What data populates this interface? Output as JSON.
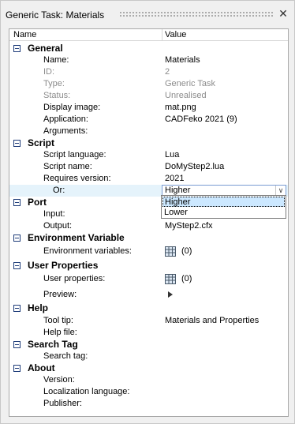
{
  "window": {
    "title": "Generic Task: Materials"
  },
  "header": {
    "name": "Name",
    "value": "Value"
  },
  "general": {
    "label": "General",
    "name_label": "Name:",
    "name_value": "Materials",
    "id_label": "ID:",
    "id_value": "2",
    "type_label": "Type:",
    "type_value": "Generic Task",
    "status_label": "Status:",
    "status_value": "Unrealised",
    "display_image_label": "Display image:",
    "display_image_value": "mat.png",
    "application_label": "Application:",
    "application_value": "CADFeko 2021 (9)",
    "arguments_label": "Arguments:"
  },
  "script": {
    "label": "Script",
    "language_label": "Script language:",
    "language_value": "Lua",
    "name_label": "Script name:",
    "name_value": "DoMyStep2.lua",
    "requires_label": "Requires version:",
    "requires_value": "2021",
    "or_label": "Or:",
    "or_value": "Higher",
    "or_options": [
      "Higher",
      "Lower"
    ]
  },
  "port": {
    "label": "Port",
    "input_label": "Input:",
    "output_label": "Output:",
    "output_value": "MyStep2.cfx"
  },
  "environment": {
    "label": "Environment Variable",
    "vars_label": "Environment variables:",
    "vars_value": "(0)"
  },
  "user_properties": {
    "label": "User Properties",
    "props_label": "User properties:",
    "props_value": "(0)",
    "preview_label": "Preview:"
  },
  "help": {
    "label": "Help",
    "tooltip_label": "Tool tip:",
    "tooltip_value": "Materials and Properties",
    "helpfile_label": "Help file:"
  },
  "search_tag": {
    "label": "Search Tag",
    "tag_label": "Search tag:"
  },
  "about": {
    "label": "About",
    "version_label": "Version:",
    "localization_label": "Localization language:",
    "publisher_label": "Publisher:"
  },
  "icons": {
    "close": "close-icon",
    "collapse": "collapse-icon",
    "table": "table-icon",
    "play": "play-icon",
    "dropdown": "chevron-down-icon"
  }
}
